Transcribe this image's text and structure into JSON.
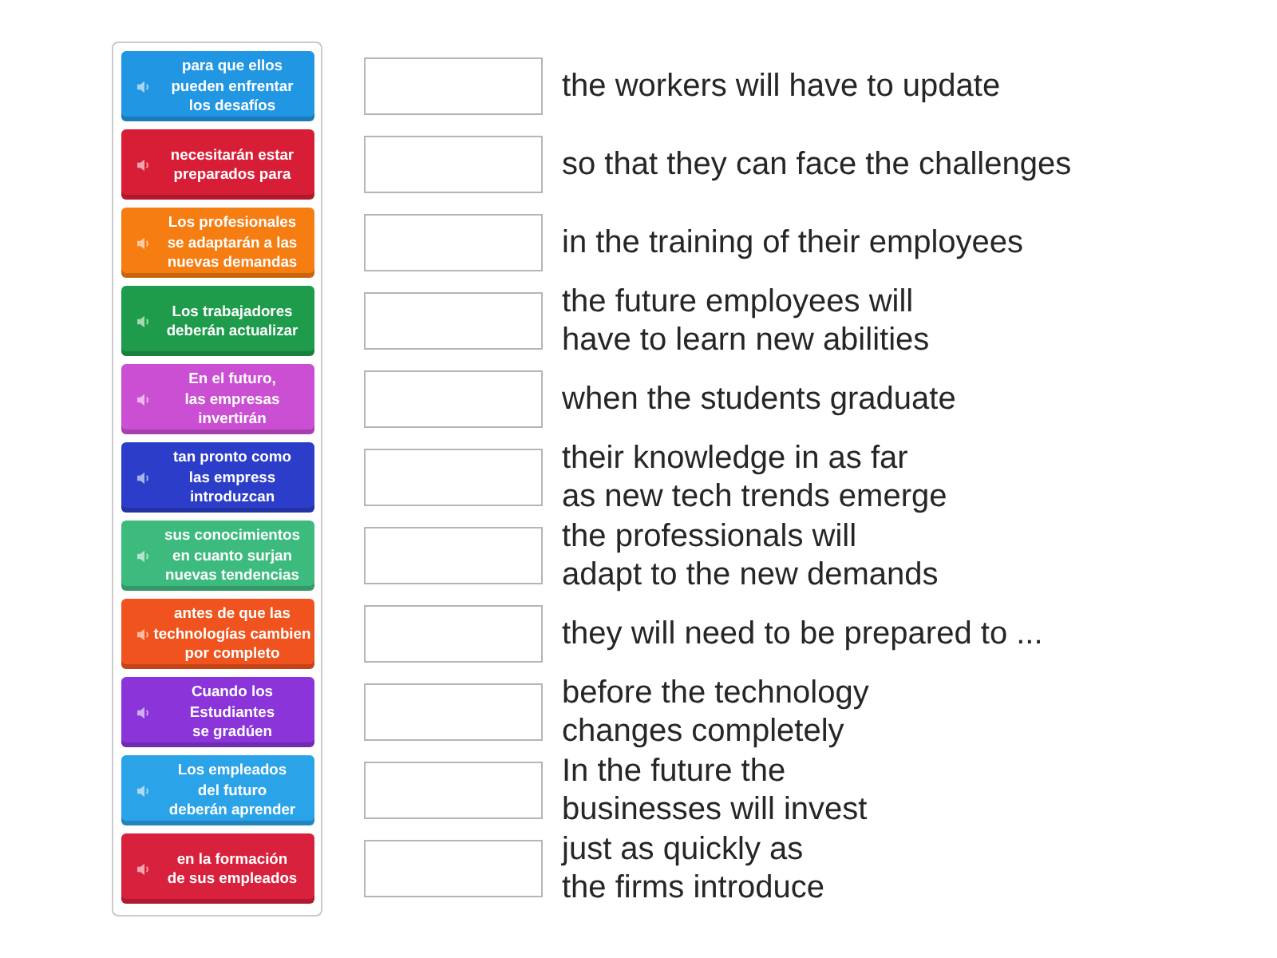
{
  "tiles": [
    {
      "text": "para que ellos\npueden enfrentar\nlos desafíos",
      "color": "#2196e3"
    },
    {
      "text": "necesitarán estar\npreparados para",
      "color": "#d81e36"
    },
    {
      "text": "Los profesionales\nse adaptarán a las\nnuevas demandas",
      "color": "#f57d12"
    },
    {
      "text": "Los trabajadores\ndeberán actualizar",
      "color": "#1f9b4c"
    },
    {
      "text": "En el futuro,\nlas empresas\ninvertirán",
      "color": "#cb4fd3"
    },
    {
      "text": "tan pronto como\nlas empress\nintroduzcan",
      "color": "#2b3dc9"
    },
    {
      "text": "sus conocimientos\nen cuanto surjan\nnuevas tendencias",
      "color": "#3dbb7e"
    },
    {
      "text": "antes de que las\ntechnologías cambien\npor completo",
      "color": "#f0531d"
    },
    {
      "text": "Cuando los\nEstudiantes\nse gradúen",
      "color": "#8a34d9"
    },
    {
      "text": "Los empleados\ndel futuro\ndeberán aprender",
      "color": "#2ba3e8"
    },
    {
      "text": "en la formación\nde sus empleados",
      "color": "#d8213c"
    }
  ],
  "rows": [
    {
      "text": "the workers will have to update"
    },
    {
      "text": "so that they can face the challenges"
    },
    {
      "text": "in the training of their employees"
    },
    {
      "text": "the future employees will\nhave to learn new abilities"
    },
    {
      "text": "when the students graduate"
    },
    {
      "text": "their knowledge in as far\nas new tech trends emerge"
    },
    {
      "text": "the professionals will\nadapt to the new demands"
    },
    {
      "text": "they will need to be prepared to ..."
    },
    {
      "text": "before the technology\nchanges completely"
    },
    {
      "text": "In the future the\nbusinesses will invest"
    },
    {
      "text": "just as quickly as\nthe firms introduce"
    }
  ]
}
